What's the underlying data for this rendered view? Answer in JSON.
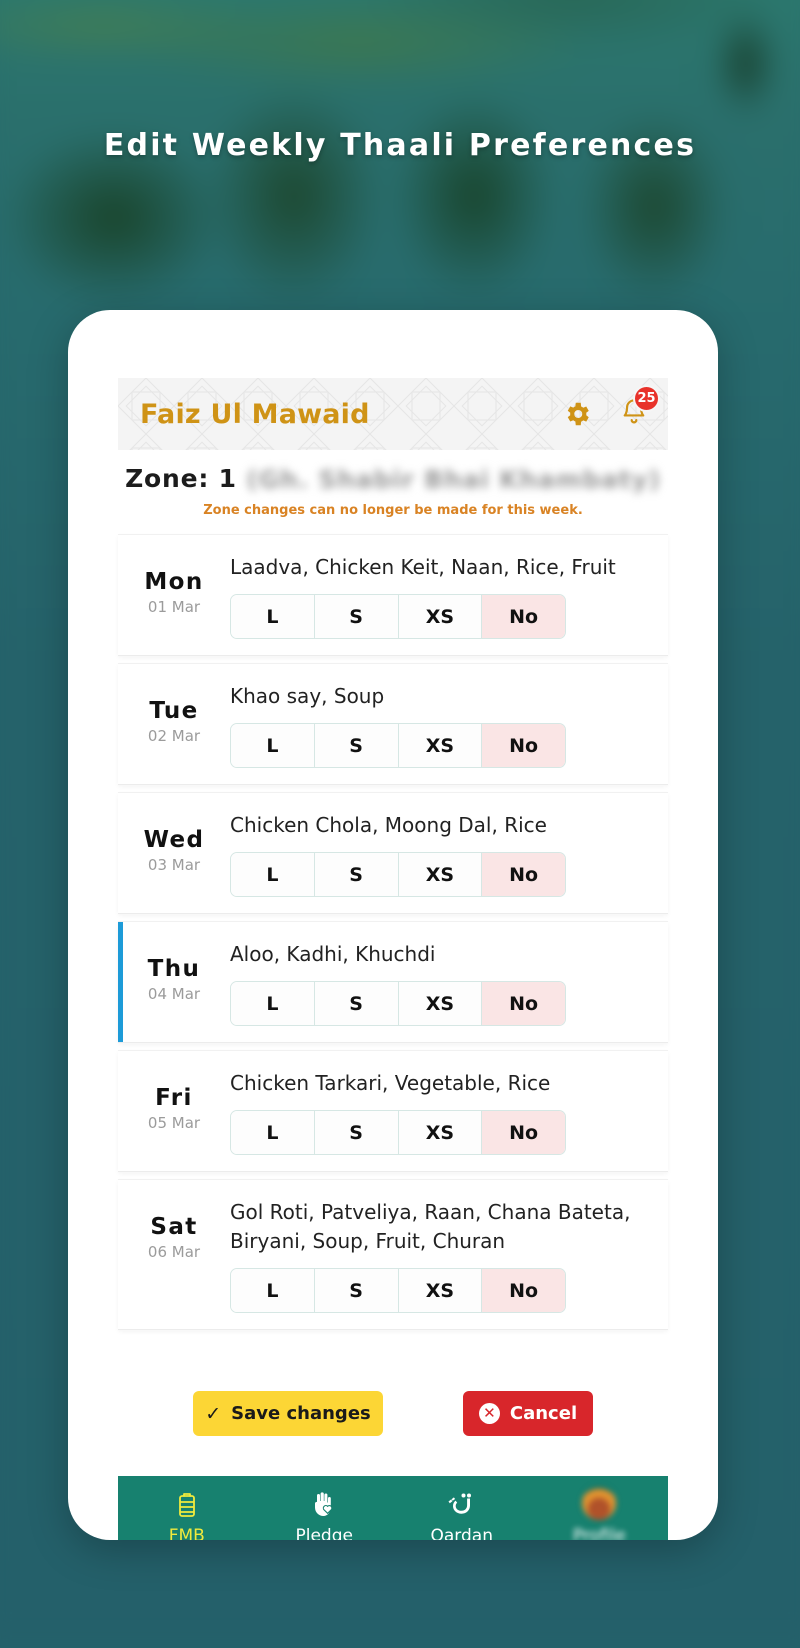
{
  "page": {
    "title": "Edit Weekly Thaali Preferences",
    "background_color": "#25626a"
  },
  "app_header": {
    "brand": "Faiz Ul Mawaid",
    "brand_color": "#cf9316",
    "settings_icon": "gear-icon",
    "notifications_icon": "bell-icon",
    "notification_count": "25",
    "badge_color": "#e8322a"
  },
  "zone": {
    "label": "Zone: 1",
    "masked_name": "(Gh. Shabir Bhai Khambaty)",
    "note": "Zone changes can no longer be made for this week.",
    "note_color": "#d98324"
  },
  "size_options": [
    "L",
    "S",
    "XS",
    "No"
  ],
  "days": [
    {
      "name": "Mon",
      "date": "01 Mar",
      "menu": "Laadva, Chicken Keit, Naan, Rice, Fruit",
      "selected": "No",
      "is_today": false
    },
    {
      "name": "Tue",
      "date": "02 Mar",
      "menu": "Khao say, Soup",
      "selected": "No",
      "is_today": false
    },
    {
      "name": "Wed",
      "date": "03 Mar",
      "menu": "Chicken Chola, Moong Dal, Rice",
      "selected": "No",
      "is_today": false
    },
    {
      "name": "Thu",
      "date": "04 Mar",
      "menu": "Aloo, Kadhi, Khuchdi",
      "selected": "No",
      "is_today": true
    },
    {
      "name": "Fri",
      "date": "05 Mar",
      "menu": "Chicken Tarkari, Vegetable, Rice",
      "selected": "No",
      "is_today": false
    },
    {
      "name": "Sat",
      "date": "06 Mar",
      "menu": "Gol Roti, Patveliya, Raan, Chana Bateta, Biryani, Soup, Fruit, Churan",
      "selected": "No",
      "is_today": false
    }
  ],
  "actions": {
    "save_label": "Save changes",
    "save_color": "#fcd635",
    "cancel_label": "Cancel",
    "cancel_color": "#d8262b"
  },
  "bottom_nav": {
    "background_color": "#17816f",
    "active_color": "#f0ea3c",
    "items": [
      {
        "label": "FMB",
        "icon": "tiffin-icon",
        "active": true
      },
      {
        "label": "Pledge",
        "icon": "hand-heart-icon",
        "active": false
      },
      {
        "label": "Qardan",
        "icon": "qaf-arabic-icon",
        "active": false
      },
      {
        "label": "Profile",
        "icon": "avatar-icon",
        "active": false
      }
    ]
  }
}
